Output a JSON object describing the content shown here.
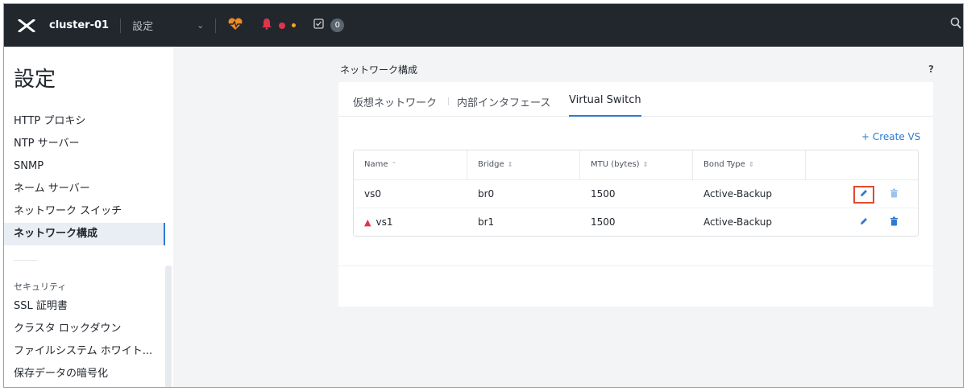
{
  "topbar": {
    "cluster_name": "cluster-01",
    "section": "設定",
    "task_count": "0",
    "colors": {
      "health": "#f08a24",
      "alert": "#e0344a",
      "warning": "#f1a61d"
    }
  },
  "sidebar": {
    "title": "設定",
    "items": [
      {
        "label": "HTTP プロキシ"
      },
      {
        "label": "NTP サーバー"
      },
      {
        "label": "SNMP"
      },
      {
        "label": "ネーム サーバー"
      },
      {
        "label": "ネットワーク スイッチ"
      },
      {
        "label": "ネットワーク構成"
      }
    ],
    "active_index": 5,
    "group_label": "セキュリティ",
    "group_items": [
      {
        "label": "SSL 証明書"
      },
      {
        "label": "クラスタ ロックダウン"
      },
      {
        "label": "ファイルシステム ホワイト..."
      },
      {
        "label": "保存データの暗号化"
      }
    ]
  },
  "main": {
    "heading": "ネットワーク構成",
    "help": "?",
    "tabs": [
      {
        "label": "仮想ネットワーク"
      },
      {
        "label": "内部インタフェース"
      },
      {
        "label": "Virtual Switch"
      }
    ],
    "active_tab": 2,
    "create_label": "+  Create VS",
    "table": {
      "columns": [
        "Name",
        "Bridge",
        "MTU (bytes)",
        "Bond Type"
      ],
      "rows": [
        {
          "name": "vs0",
          "bridge": "br0",
          "mtu": "1500",
          "bond": "Active-Backup",
          "warning": false
        },
        {
          "name": "vs1",
          "bridge": "br1",
          "mtu": "1500",
          "bond": "Active-Backup",
          "warning": true
        }
      ]
    },
    "accent_color": "#2e7ad1",
    "highlight_color": "#e24a2c"
  }
}
